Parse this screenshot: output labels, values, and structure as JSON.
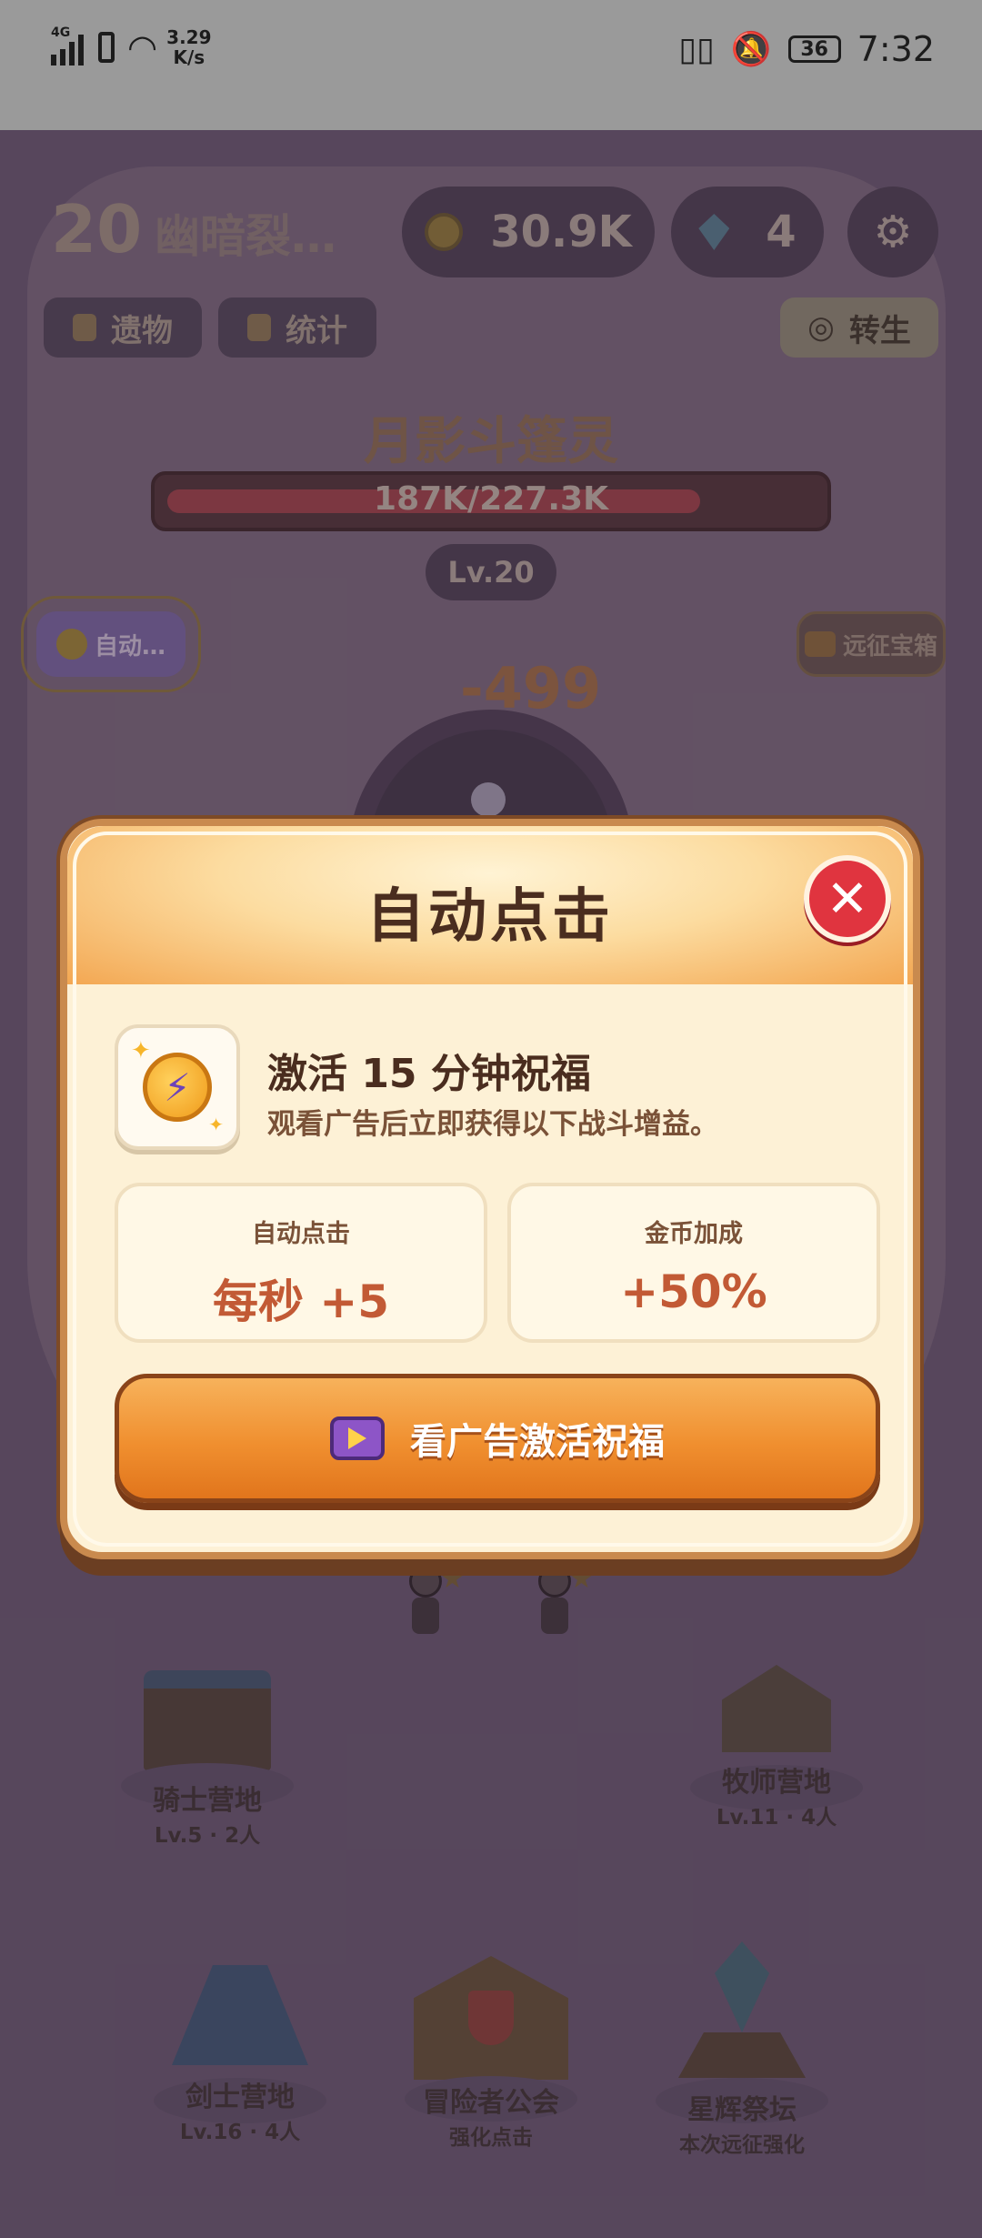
{
  "status_bar": {
    "network": "4G",
    "speed_value": "3.29",
    "speed_unit": "K/s",
    "battery": "36",
    "time": "7:32"
  },
  "header": {
    "level": "20",
    "zone_name": "幽暗裂…",
    "coins": "30.9K",
    "gems": "4"
  },
  "buttons": {
    "relics": "遗物",
    "stats": "统计",
    "rebirth": "转生",
    "auto": "自动…",
    "expedition_chest": "远征宝箱"
  },
  "boss": {
    "name": "月影斗篷灵",
    "hp_text": "187K/227.3K",
    "hp_fraction": 0.823,
    "level": "Lv.20",
    "damage_popup": "-499"
  },
  "camps": [
    {
      "name": "骑士营地",
      "sub": "Lv.5 · 2人"
    },
    {
      "name": "牧师营地",
      "sub": "Lv.11 · 4人"
    },
    {
      "name": "剑士营地",
      "sub": "Lv.16 · 4人"
    },
    {
      "name": "冒险者公会",
      "sub": "强化点击"
    },
    {
      "name": "星辉祭坛",
      "sub": "本次远征强化"
    }
  ],
  "modal": {
    "title": "自动点击",
    "close": "✕",
    "activate_title": "激活 15 分钟祝福",
    "activate_desc": "观看广告后立即获得以下战斗增益。",
    "cards": [
      {
        "label": "自动点击",
        "value": "每秒 +5"
      },
      {
        "label": "金币加成",
        "value": "+50%"
      }
    ],
    "watch_ad_label": "看广告激活祝福"
  },
  "colors": {
    "modal_bg": "#fdf1d6",
    "accent_orange": "#f08f2f",
    "close_red": "#e0343f",
    "value_red": "#c25a35"
  }
}
